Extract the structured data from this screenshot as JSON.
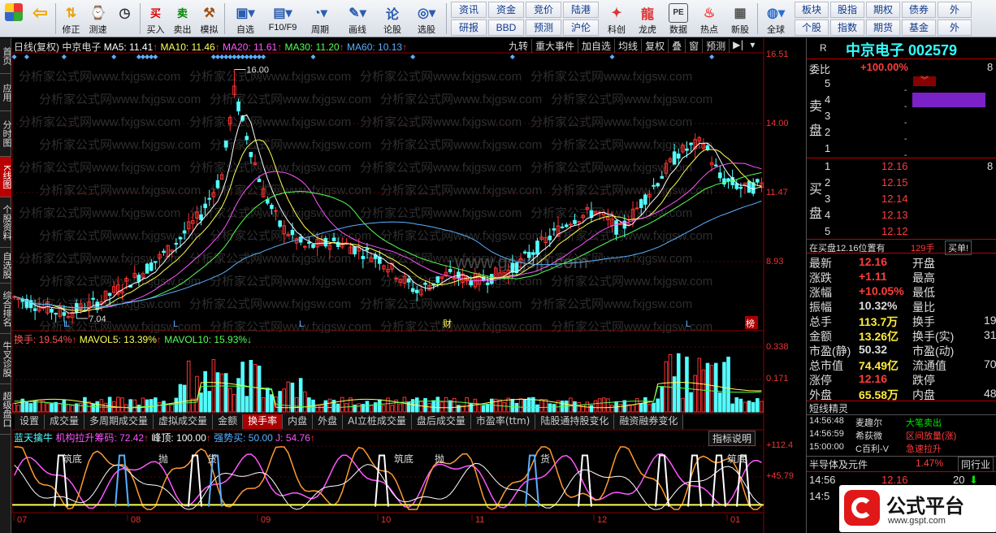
{
  "toolbar": {
    "buttons": [
      {
        "label": "",
        "icon": "grid-logo-icon"
      },
      {
        "label": "",
        "icon": "back-arrow-icon"
      },
      {
        "label": "修正",
        "icon": "up-down-arrow-icon"
      },
      {
        "label": "测速",
        "icon": "speed-icon"
      },
      {
        "label": "",
        "icon": "clock-icon"
      },
      {
        "label": "买入",
        "icon": "buy-icon"
      },
      {
        "label": "卖出",
        "icon": "sell-icon"
      },
      {
        "label": "模拟",
        "icon": "hammer-icon"
      },
      {
        "label": "自选",
        "icon": "portfolio-icon"
      },
      {
        "label": "F10/F9",
        "icon": "f10-icon"
      },
      {
        "label": "周期",
        "icon": "period-icon"
      },
      {
        "label": "画线",
        "icon": "pencil-icon"
      },
      {
        "label": "论股",
        "icon": "discuss-icon"
      },
      {
        "label": "选股",
        "icon": "select-stock-icon"
      }
    ],
    "grid1": [
      "资讯",
      "资金",
      "竞价",
      "陆港",
      "研报",
      "BBD",
      "预测",
      "沪伦"
    ],
    "grid_icons": [
      {
        "label": "科创"
      },
      {
        "label": "龙虎"
      },
      {
        "label": "数据"
      },
      {
        "label": "热点"
      },
      {
        "label": "新股"
      }
    ],
    "globe": "全球",
    "grid2": [
      "板块",
      "股指",
      "期权",
      "债券",
      "外",
      "个股",
      "指数",
      "期货",
      "基金",
      "外"
    ]
  },
  "left_tabs": [
    "首页",
    "应用",
    "分时图",
    "K线图",
    "个股资料",
    "自选股",
    "综合排名",
    "牛叉诊股",
    "超级盘口"
  ],
  "legend_top": {
    "prefix": "日线(复权)",
    "name": "中京电子",
    "ma5": "MA5: 11.41",
    "ma10": "MA10: 11.46",
    "ma20": "MA20: 11.61",
    "ma30": "MA30: 11.20",
    "ma60": "MA60: 10.13"
  },
  "chart_buttons": [
    "九转",
    "重大事件",
    "加自选",
    "均线",
    "复权",
    "叠",
    "窗",
    "预测"
  ],
  "price_axis": [
    "16.51",
    "14.00",
    "11.47",
    "8.93"
  ],
  "price_marks": {
    "high": "16.00",
    "low": "7.04"
  },
  "vol_legend": {
    "turnover": "换手: 19.54%",
    "mavol5": "MAVOL5: 13.39%",
    "mavol10": "MAVOL10: 15.93%"
  },
  "vol_axis": [
    "0.338",
    "0.171"
  ],
  "bottom_tabs": [
    "设置",
    "成交量",
    "多周期成交量",
    "虚拟成交量",
    "金额",
    "换手率",
    "内盘",
    "外盘",
    "AI立桩成交量",
    "盘后成交量",
    "市盈率(ttm)",
    "陆股通持股变化",
    "融资融券变化"
  ],
  "indicator_button": "指标说明",
  "indicator_legend": {
    "name": "蓝天擒牛",
    "jgl": "机构拉升筹码: 72.42",
    "peak": "峰顶: 100.00",
    "strong": "强势买: 50.00",
    "j": "J: 54.76"
  },
  "ind_axis": [
    "+112.4",
    "+45.79"
  ],
  "ind_labels": [
    "筑底",
    "抛",
    "货",
    "筑底",
    "抛",
    "货",
    "筑底"
  ],
  "date_axis": [
    "07",
    "08",
    "09",
    "10",
    "11",
    "12",
    "01"
  ],
  "L_marks": [
    "L",
    "L",
    "L",
    "L",
    "L"
  ],
  "fin_mark": "财",
  "bang_mark": "榜",
  "watermark_line": "分析家公式网www.fxjgsw.com",
  "watermark_center": "www.gsgsjp.com",
  "quote": {
    "code_label": "R",
    "name": "中京电子 002579",
    "weibi_label": "委比",
    "weibi": "+100.00%",
    "weibi_tail": "8",
    "sell_label": [
      "卖",
      "盘"
    ],
    "sells": [
      "5",
      "4",
      "3",
      "2",
      "1"
    ],
    "buy_label": [
      "买",
      "盘"
    ],
    "buys": [
      {
        "n": "1",
        "p": "12.16",
        "v": "8"
      },
      {
        "n": "2",
        "p": "12.15",
        "v": ""
      },
      {
        "n": "3",
        "p": "12.14",
        "v": ""
      },
      {
        "n": "4",
        "p": "12.13",
        "v": ""
      },
      {
        "n": "5",
        "p": "12.12",
        "v": ""
      }
    ],
    "queue": "在买盘12.16位置有",
    "queue_vol": "129手",
    "queue_btn": "买单!",
    "stats": [
      {
        "l": "最新",
        "v": "12.16",
        "l2": "开盘",
        "v2": ""
      },
      {
        "l": "涨跌",
        "v": "+1.11",
        "l2": "最高",
        "v2": ""
      },
      {
        "l": "涨幅",
        "v": "+10.05%",
        "l2": "最低",
        "v2": ""
      },
      {
        "l": "振幅",
        "v": "10.32%",
        "l2": "量比",
        "v2": ""
      },
      {
        "l": "总手",
        "v": "113.7万",
        "l2": "换手",
        "v2": "19"
      },
      {
        "l": "金额",
        "v": "13.26亿",
        "l2": "换手(实)",
        "v2": "31"
      },
      {
        "l": "市盈(静)",
        "v": "50.32",
        "l2": "市盈(动)",
        "v2": ""
      },
      {
        "l": "总市值",
        "v": "74.49亿",
        "l2": "流通值",
        "v2": "70"
      },
      {
        "l": "涨停",
        "v": "12.16",
        "l2": "跌停",
        "v2": ""
      },
      {
        "l": "外盘",
        "v": "65.58万",
        "l2": "内盘",
        "v2": "48"
      }
    ],
    "short_title": "短线精灵",
    "short": [
      {
        "t": "14:56:48",
        "n": "麦趣尔",
        "e": "大笔卖出"
      },
      {
        "t": "14:56:59",
        "n": "希荻微",
        "e": "区间放量(涨)"
      },
      {
        "t": "15:00:00",
        "n": "C百利-V",
        "e": "急速拉升"
      }
    ],
    "sector": "半导体及元件",
    "sector_pct": "1.47%",
    "sector_btn": "同行业",
    "tick_time": "14:56",
    "tick_price": "12.16",
    "tick_vol": "20",
    "tick_time2": "14:5"
  },
  "brand": {
    "text": "公式平台",
    "url": "www.gspt.com"
  },
  "colors": {
    "up": "#ff3232",
    "down": "#54ffff",
    "ma5": "#ffffff",
    "ma10": "#ffff55",
    "ma20": "#ff55ff",
    "ma30": "#55ff55",
    "ma60": "#5ab0ff"
  }
}
